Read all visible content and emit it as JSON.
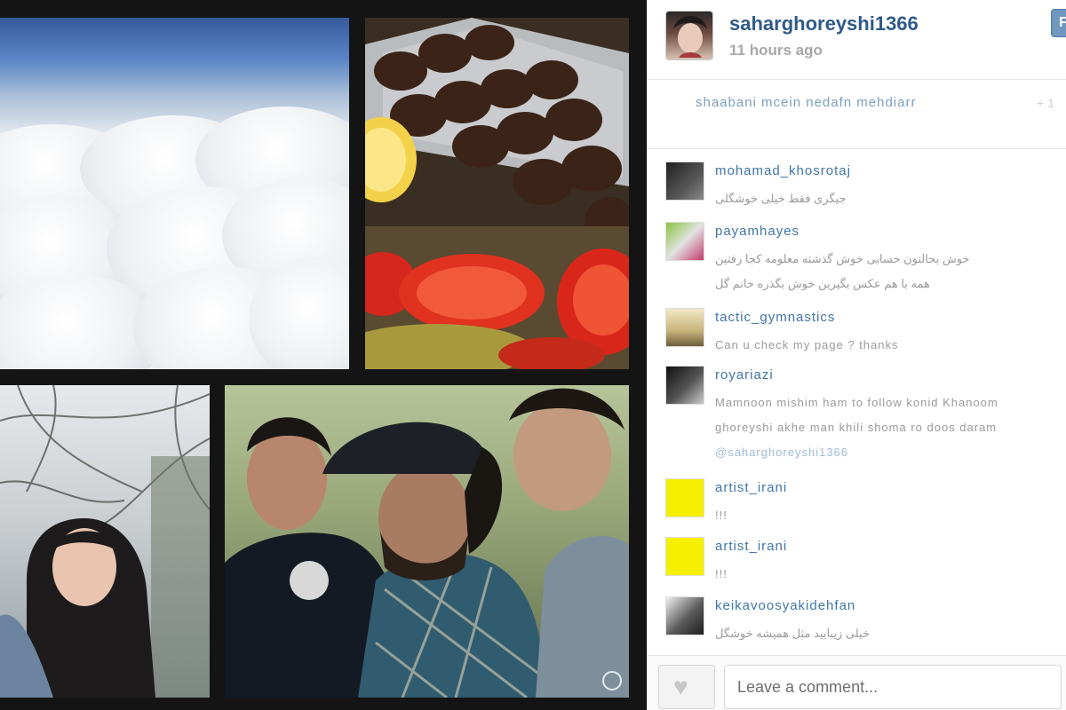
{
  "post": {
    "username": "saharghoreyshi1366",
    "time_ago": "11 hours ago",
    "follow_label": "F"
  },
  "likes": {
    "names": "shaabani  mcein  nedafn  mehdiarr",
    "more": "+ 1"
  },
  "comments": [
    {
      "user": "mohamad_khosrotaj",
      "lines": [
        "جیگری فقط خیلی خوشگلی"
      ],
      "avatar": "av1"
    },
    {
      "user": "payamhayes",
      "lines": [
        "خوش بحالتون حسابی خوش گذشته معلومه کجا رفتین",
        "همه با هم عکس بگیرین خوش بگذره خانم گل"
      ],
      "avatar": "av2"
    },
    {
      "user": "tactic_gymnastics",
      "lines": [
        "Can u check my page ? thanks"
      ],
      "avatar": "av3"
    },
    {
      "user": "royariazi",
      "lines": [
        "Mamnoon mishim ham to follow konid Khanoom",
        "ghoreyshi akhe man khili shoma ro doos daram",
        "@saharghoreyshi1366"
      ],
      "link_line": 2,
      "avatar": "av4"
    },
    {
      "user": "artist_irani",
      "lines": [
        "!!!"
      ],
      "avatar": "av5"
    },
    {
      "user": "artist_irani",
      "lines": [
        "!!!"
      ],
      "avatar": "av5"
    },
    {
      "user": "keikavoosyakidehfan",
      "lines": [
        "خیلی زیبایید مثل همیشه خوشگل"
      ],
      "avatar": "av6"
    }
  ],
  "footer": {
    "comment_placeholder": "Leave a comment...",
    "like_icon": "heart-icon"
  },
  "colors": {
    "username": "#2f5a87",
    "link": "#3f75a8",
    "muted": "#a8a8a8",
    "follow_button": "#6f97c0"
  }
}
